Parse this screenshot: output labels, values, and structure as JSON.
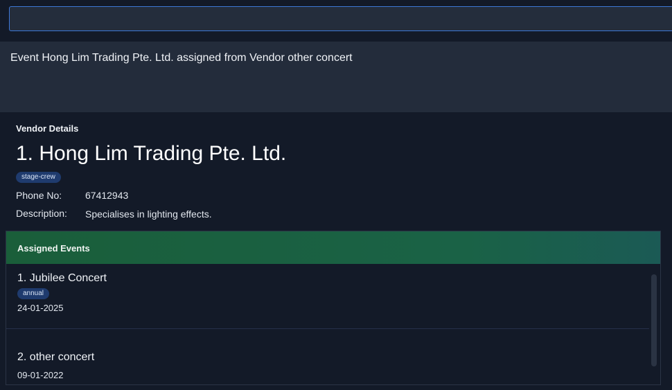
{
  "command": {
    "value": "",
    "placeholder": ""
  },
  "result": {
    "message": "Event Hong Lim Trading Pte. Ltd. assigned from Vendor other concert"
  },
  "vendor": {
    "heading": "Vendor Details",
    "name": "1. Hong Lim Trading Pte. Ltd.",
    "tag": "stage-crew",
    "phone_label": "Phone No:",
    "phone": "67412943",
    "description_label": "Description:",
    "description": "Specialises in lighting effects."
  },
  "events": {
    "header": "Assigned Events",
    "items": [
      {
        "title": "1. Jubilee Concert",
        "tag": "annual",
        "date": "24-01-2025"
      },
      {
        "title": "2. other concert",
        "tag": "",
        "date": "09-01-2022"
      }
    ]
  },
  "colors": {
    "accent_border": "#3d78d8",
    "header_green": "#1a5e3a",
    "tag_bg": "#1f3b6e",
    "background": "#131a28"
  }
}
